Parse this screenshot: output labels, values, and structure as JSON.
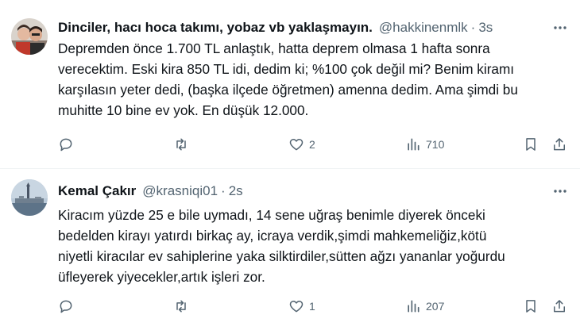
{
  "tweets": [
    {
      "name": "Dinciler, hacı hoca takımı, yobaz vb yaklaşmayın.",
      "handle": "@hakkinenmlk",
      "time": "3s",
      "text": "Depremden önce 1.700 TL anlaştık, hatta deprem olmasa 1 hafta sonra\nverecektim. Eski kira 850 TL idi, dedim ki; %100 çok değil mi? Benim kiramı\nkarşılasın yeter dedi, (başka ilçede öğretmen) amenna dedim. Ama şimdi bu\nmuhitte 10 bine ev yok. En düşük 12.000.",
      "likes": "2",
      "views": "710",
      "avatar_icon": "user-photo-avatar"
    },
    {
      "name": "Kemal Çakır",
      "handle": "@krasniqi01",
      "time": "2s",
      "text": "Kiracım yüzde 25 e bile uymadı, 14 sene uğraş benimle diyerek önceki\nbedelden kirayı yatırdı birkaç ay, icraya verdik,şimdi mahkemeliğiz,kötü\nniyetli kiracılar ev sahiplerine yaka silktirdiler,sütten ağzı yananlar yoğurdu\nüfleyerek yiyecekler,artık işleri zor.",
      "likes": "1",
      "views": "207",
      "avatar_icon": "landscape-photo-avatar"
    }
  ],
  "separator": "·",
  "colors": {
    "text": "#0f1419",
    "secondary": "#536471",
    "divider": "#eff3f4"
  }
}
